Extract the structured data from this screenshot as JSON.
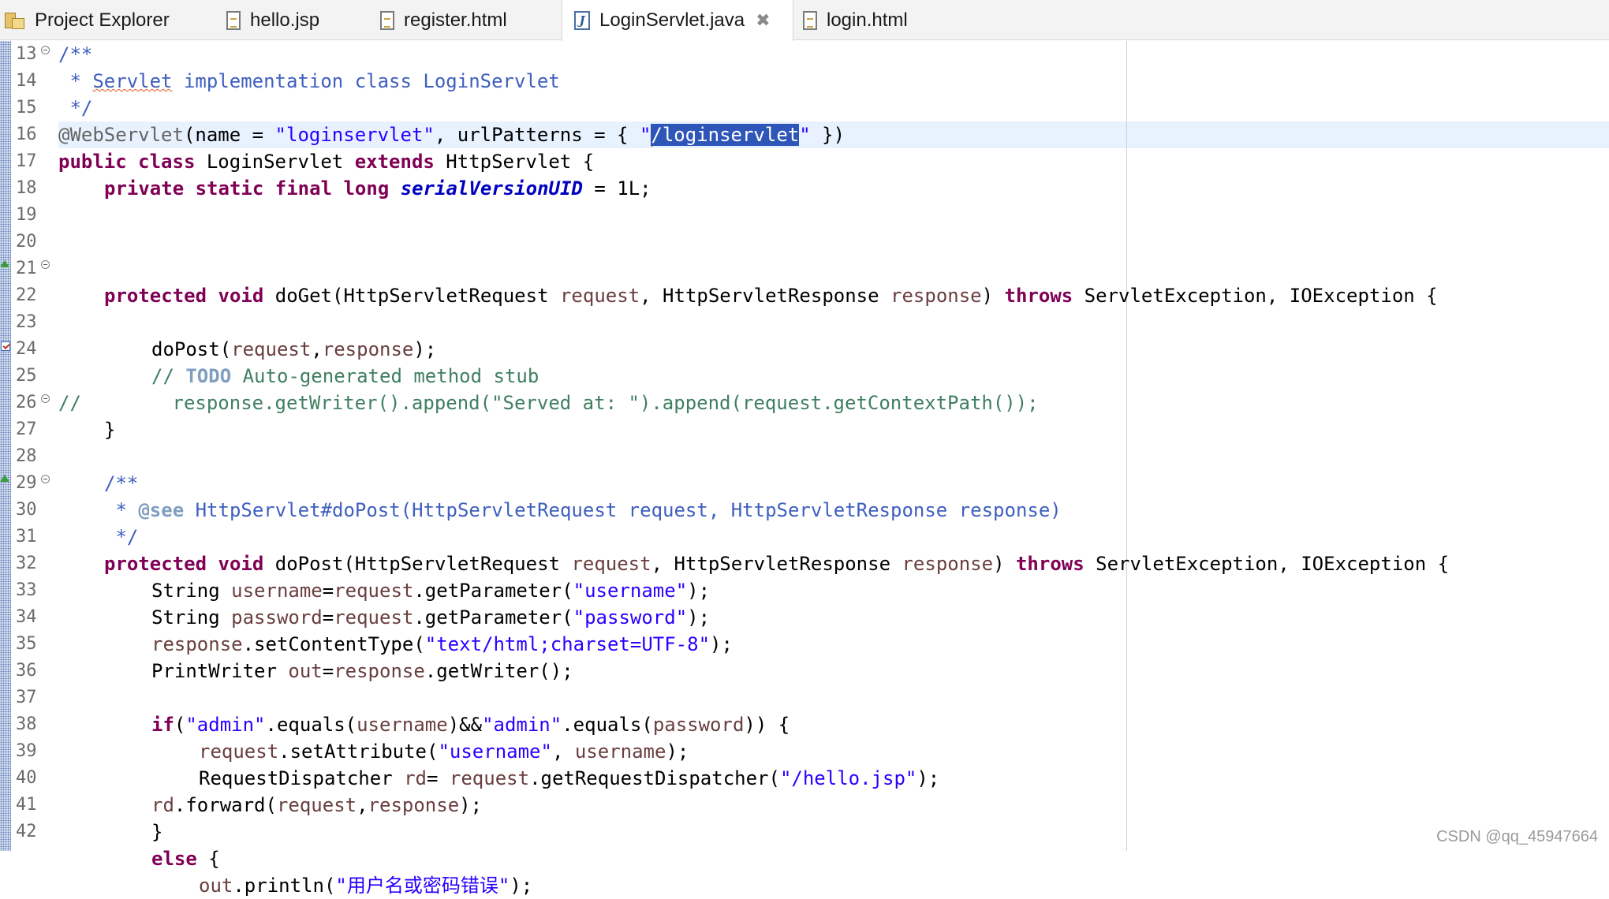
{
  "tabs": [
    {
      "label": "Project Explorer",
      "icon": "project-explorer-icon"
    },
    {
      "label": "hello.jsp",
      "icon": "file-icon"
    },
    {
      "label": "register.html",
      "icon": "file-icon"
    },
    {
      "label": "LoginServlet.java",
      "icon": "java-file-icon",
      "active": true,
      "closable": true
    },
    {
      "label": "login.html",
      "icon": "file-icon"
    }
  ],
  "editor": {
    "line_numbers": [
      "13",
      "14",
      "15",
      "16",
      "17",
      "18",
      "19",
      "20",
      "21",
      "22",
      "23",
      "24",
      "25",
      "26",
      "27",
      "28",
      "29",
      "30",
      "31",
      "32",
      "33",
      "34",
      "35",
      "36",
      "37",
      "38",
      "39",
      "40",
      "41",
      "42"
    ],
    "current_line": "16",
    "selected_text": "/loginservlet",
    "code": {
      "l13": "/**",
      "l14_a": " * ",
      "l14_b": "Servlet",
      "l14_c": " implementation class LoginServlet",
      "l15": " */",
      "l16_a": "@WebServlet",
      "l16_b": "(name = ",
      "l16_c": "\"loginservlet\"",
      "l16_d": ", urlPatterns = { ",
      "l16_e": "\"",
      "l16_f": "/loginservlet",
      "l16_g": "\"",
      "l16_h": " })",
      "l17_a": "public",
      "l17_b": " ",
      "l17_c": "class",
      "l17_d": " LoginServlet ",
      "l17_e": "extends",
      "l17_f": " HttpServlet {",
      "l18_a": "private",
      "l18_b": "static",
      "l18_c": "final",
      "l18_d": "long",
      "l18_e": "serialVersionUID",
      "l18_f": " = 1L;",
      "l21_a": "protected",
      "l21_b": "void",
      "l21_c": " doGet(HttpServletRequest ",
      "l21_d": "request",
      "l21_e": ", HttpServletResponse ",
      "l21_f": "response",
      "l21_g": ") ",
      "l21_h": "throws",
      "l21_i": " ServletException, IOException {",
      "l23_a": "doPost(",
      "l23_b": "request",
      "l23_c": ",",
      "l23_d": "response",
      "l23_e": ");",
      "l24_a": "// ",
      "l24_b": "TODO",
      "l24_c": " Auto-generated method stub",
      "l25": "//        response.getWriter().append(\"Served at: \").append(request.getContextPath());",
      "l26": "}",
      "l28": "/**",
      "l29_a": " * ",
      "l29_b": "@see",
      "l29_c": " HttpServlet#doPost(HttpServletRequest request, HttpServletResponse response)",
      "l30": " */",
      "l31_a": "protected",
      "l31_b": "void",
      "l31_c": " doPost(HttpServletRequest ",
      "l31_d": "request",
      "l31_e": ", HttpServletResponse ",
      "l31_f": "response",
      "l31_g": ") ",
      "l31_h": "throws",
      "l31_i": " ServletException, IOException {",
      "l32_a": "String ",
      "l32_b": "username",
      "l32_c": "=",
      "l32_d": "request",
      "l32_e": ".getParameter(",
      "l32_f": "\"username\"",
      "l32_g": ");",
      "l33_a": "String ",
      "l33_b": "password",
      "l33_c": "=",
      "l33_d": "request",
      "l33_e": ".getParameter(",
      "l33_f": "\"password\"",
      "l33_g": ");",
      "l34_a": "response",
      "l34_b": ".setContentType(",
      "l34_c": "\"text/html;charset=UTF-8\"",
      "l34_d": ");",
      "l35_a": "PrintWriter ",
      "l35_b": "out",
      "l35_c": "=",
      "l35_d": "response",
      "l35_e": ".getWriter();",
      "l37_a": "if",
      "l37_b": "(",
      "l37_c": "\"admin\"",
      "l37_d": ".equals(",
      "l37_e": "username",
      "l37_f": ")&&",
      "l37_g": "\"admin\"",
      "l37_h": ".equals(",
      "l37_i": "password",
      "l37_j": ")) {",
      "l38_a": "request",
      "l38_b": ".setAttribute(",
      "l38_c": "\"username\"",
      "l38_d": ", ",
      "l38_e": "username",
      "l38_f": ");",
      "l39_a": "RequestDispatcher ",
      "l39_b": "rd",
      "l39_c": "= ",
      "l39_d": "request",
      "l39_e": ".getRequestDispatcher(",
      "l39_f": "\"/hello.jsp\"",
      "l39_g": ");",
      "l40_a": "rd",
      "l40_b": ".forward(",
      "l40_c": "request",
      "l40_d": ",",
      "l40_e": "response",
      "l40_f": ");",
      "l41": "}",
      "l42_a": "else",
      "l42_b": " {",
      "l43_a": "out",
      "l43_b": ".println(",
      "l43_c": "\"用户名或密码错误\"",
      "l43_d": ");"
    }
  },
  "watermark": "CSDN @qq_45947664",
  "colors": {
    "keyword": "#7f0055",
    "string": "#2a00ff",
    "comment": "#3f7f5f",
    "javadoc": "#3f5fbf",
    "variable": "#6a3e3e",
    "selection": "#2e55b8",
    "current_line": "#e8f2fe"
  }
}
